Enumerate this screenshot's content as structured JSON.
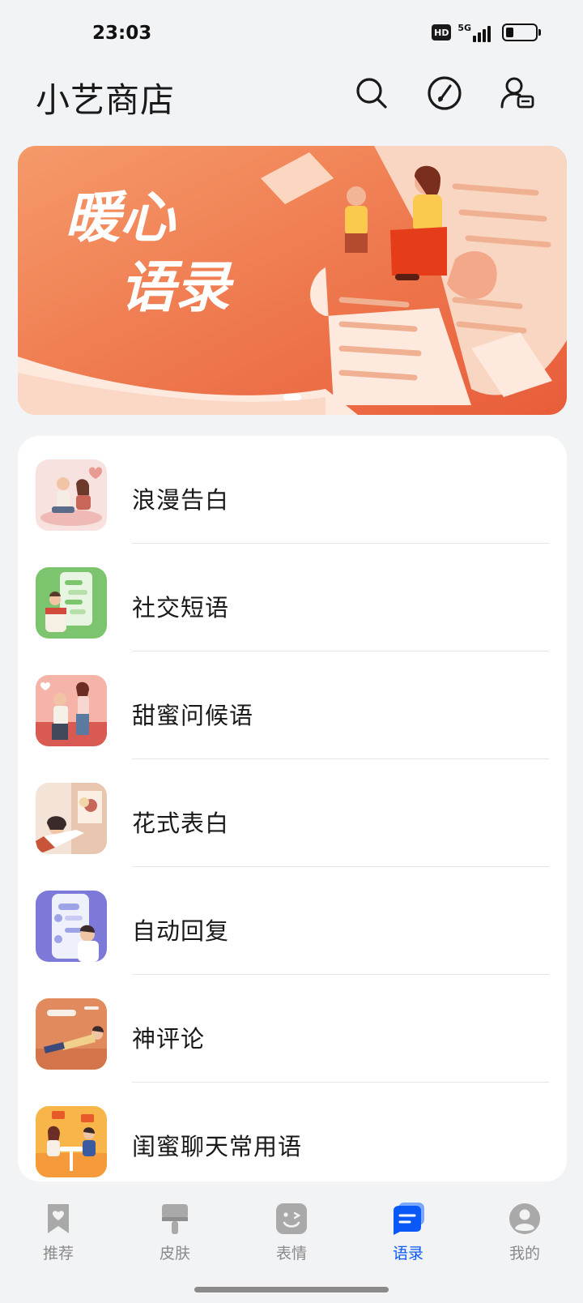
{
  "status_bar": {
    "time": "23:03",
    "hd_label": "HD",
    "network_label": "5G",
    "battery_percent": 25
  },
  "header": {
    "title": "小艺商店",
    "icons": [
      "search-icon",
      "compass-icon",
      "user-message-icon"
    ]
  },
  "banner": {
    "image_name": "warm-quotes-banner",
    "line1": "暖心",
    "line2": "语录",
    "accent_color": "#f0704a",
    "active_slide": 1,
    "slide_count": 1
  },
  "list": {
    "items": [
      {
        "label": "浪漫告白",
        "icon": "couple-romance-thumb"
      },
      {
        "label": "社交短语",
        "icon": "chat-phone-thumb"
      },
      {
        "label": "甜蜜问候语",
        "icon": "sweet-greeting-thumb"
      },
      {
        "label": "花式表白",
        "icon": "flower-confession-thumb"
      },
      {
        "label": "自动回复",
        "icon": "auto-reply-thumb"
      },
      {
        "label": "神评论",
        "icon": "comment-relax-thumb"
      },
      {
        "label": "闺蜜聊天常用语",
        "icon": "friends-chat-thumb"
      }
    ]
  },
  "bottom_nav": {
    "active_color": "#0a59f7",
    "inactive_color": "#8a8a8a",
    "items": [
      {
        "label": "推荐",
        "icon": "bookmark-heart-icon",
        "active": false
      },
      {
        "label": "皮肤",
        "icon": "paint-brush-icon",
        "active": false
      },
      {
        "label": "表情",
        "icon": "wink-face-icon",
        "active": false
      },
      {
        "label": "语录",
        "icon": "message-lines-icon",
        "active": true
      },
      {
        "label": "我的",
        "icon": "profile-icon",
        "active": false
      }
    ]
  }
}
